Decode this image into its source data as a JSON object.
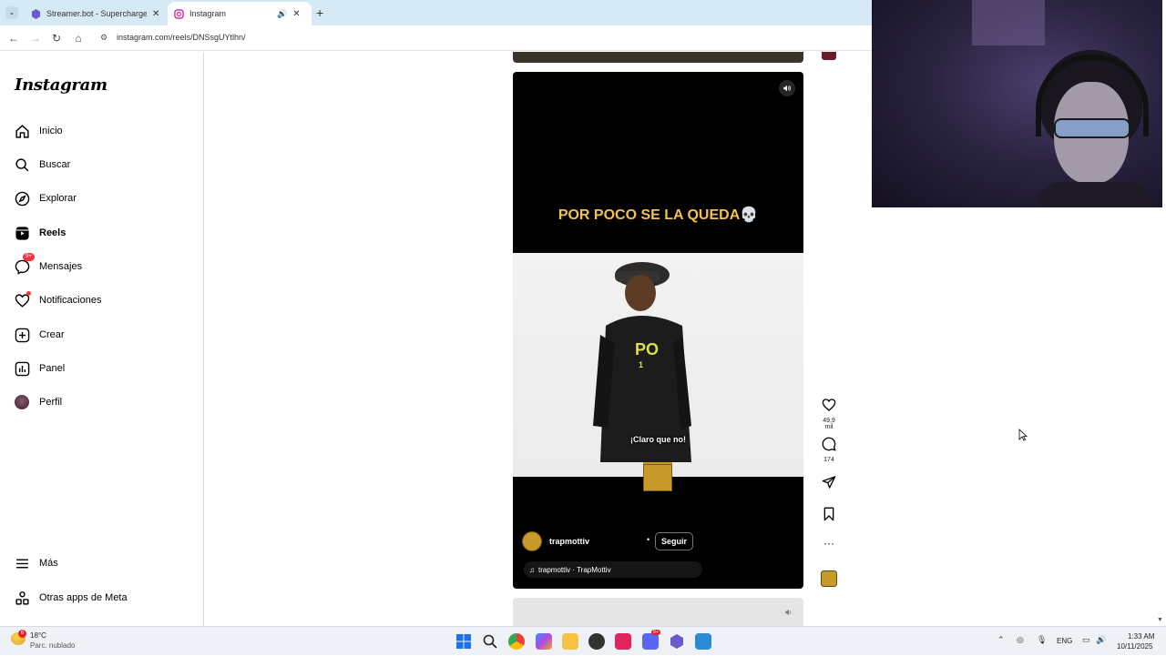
{
  "browser": {
    "tabs": [
      {
        "title": "Streamer.bot - Supercharge yo",
        "active": false
      },
      {
        "title": "Instagram",
        "active": true
      }
    ],
    "url": "instagram.com/reels/DNSsgUYtlhn/"
  },
  "instagram": {
    "logo": "Instagram",
    "nav": [
      {
        "label": "Inicio",
        "icon": "home-icon"
      },
      {
        "label": "Buscar",
        "icon": "search-icon"
      },
      {
        "label": "Explorar",
        "icon": "compass-icon"
      },
      {
        "label": "Reels",
        "icon": "reels-icon"
      },
      {
        "label": "Mensajes",
        "icon": "messenger-icon",
        "badge": "9+"
      },
      {
        "label": "Notificaciones",
        "icon": "heart-icon"
      },
      {
        "label": "Crear",
        "icon": "plus-icon"
      },
      {
        "label": "Panel",
        "icon": "dashboard-icon"
      },
      {
        "label": "Perfil",
        "icon": "avatar-icon"
      }
    ],
    "more": "Más",
    "meta_apps": "Otras apps de Meta"
  },
  "reel": {
    "caption": "POR POCO SE LA QUEDA💀",
    "subtitle": "¡Claro que no!",
    "username": "trapmottiv",
    "follow": "Seguir",
    "follow_separator": "•",
    "audio": "trapmottiv · TrapMottiv",
    "likes": "49,9 mil",
    "comments": "174"
  },
  "taskbar": {
    "weather_badge": "6",
    "temperature": "18°C",
    "condition": "Parc. nublado",
    "language": "ENG",
    "time": "1:33 AM",
    "date": "10/11/2025",
    "messenger_badge": "9+"
  },
  "colors": {
    "caption": "#f2c14e",
    "notification": "#ff3040",
    "tabbar": "#d6eaf5"
  }
}
